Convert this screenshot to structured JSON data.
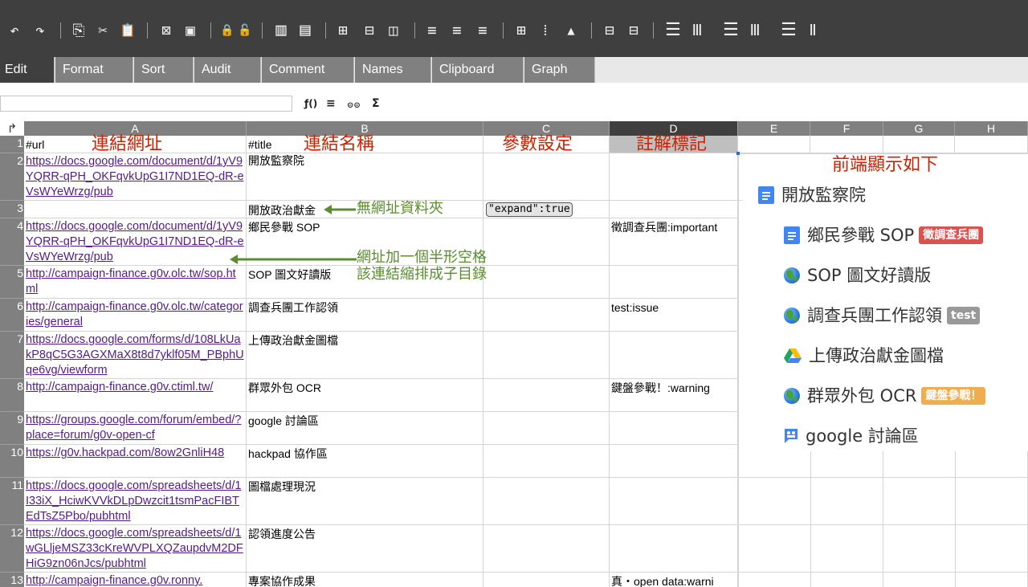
{
  "toolbar": {
    "buttons": [
      {
        "name": "undo-icon",
        "glyph": "↶"
      },
      {
        "name": "redo-icon",
        "glyph": "↷"
      },
      {
        "name": "copy-icon",
        "glyph": "⎘"
      },
      {
        "name": "cut-icon",
        "glyph": "✂"
      },
      {
        "name": "paste-icon",
        "glyph": "📋"
      },
      {
        "name": "delete-contents-icon",
        "glyph": "⊠"
      },
      {
        "name": "paste-formats-icon",
        "glyph": "▣"
      },
      {
        "name": "lock-icon",
        "glyph": "🔒"
      },
      {
        "name": "unlock-icon",
        "glyph": "🔓"
      },
      {
        "name": "freeze-columns-icon",
        "glyph": "▥"
      },
      {
        "name": "freeze-rows-icon",
        "glyph": "▤"
      },
      {
        "name": "merge-cells-icon",
        "glyph": "⊞"
      },
      {
        "name": "insert-row-icon",
        "glyph": "⊟"
      },
      {
        "name": "insert-column-icon",
        "glyph": "◫"
      },
      {
        "name": "align-left-icon",
        "glyph": "≡"
      },
      {
        "name": "align-center-icon",
        "glyph": "≡"
      },
      {
        "name": "align-right-icon",
        "glyph": "≡"
      },
      {
        "name": "borders-icon",
        "glyph": "⊞"
      },
      {
        "name": "no-borders-icon",
        "glyph": "⁞"
      },
      {
        "name": "fill-color-icon",
        "glyph": "▲"
      },
      {
        "name": "show-gridlines-icon",
        "glyph": "⊟"
      },
      {
        "name": "hide-gridlines-icon",
        "glyph": "⊟"
      },
      {
        "name": "insert-rows-icon",
        "glyph": "☰"
      },
      {
        "name": "insert-columns-icon",
        "glyph": "Ⅲ"
      },
      {
        "name": "delete-rows-icon",
        "glyph": "☰"
      },
      {
        "name": "delete-columns-icon",
        "glyph": "Ⅲ"
      },
      {
        "name": "hide-rows-icon",
        "glyph": "☰"
      },
      {
        "name": "hide-columns-icon",
        "glyph": "Ⅱ"
      }
    ]
  },
  "tabs": [
    "Edit",
    "Format",
    "Sort",
    "Audit",
    "Comment",
    "Names",
    "Clipboard",
    "Graph"
  ],
  "formula_bar": {
    "value": "",
    "icons": [
      {
        "name": "function-icon",
        "glyph": "ƒ()"
      },
      {
        "name": "multiline-icon",
        "glyph": "≡"
      },
      {
        "name": "link-icon",
        "glyph": "⊝⊝"
      },
      {
        "name": "sum-icon",
        "glyph": "Σ"
      }
    ]
  },
  "grid": {
    "corner_glyph": "↱",
    "columns": [
      "A",
      "B",
      "C",
      "D",
      "E",
      "F",
      "G",
      "H"
    ],
    "selected_column": "D",
    "rows": [
      {
        "num": "1",
        "a": "#url",
        "b": "#title",
        "c": "",
        "d": ""
      },
      {
        "num": "2",
        "a": "https://docs.google.com/document/d/1yV9YQRR-qPH_OKFqvkUpG1I7ND1EQ-dR-eVsWYeWrzg/pub",
        "b": "開放監察院",
        "c": "",
        "d": ""
      },
      {
        "num": "3",
        "a": "",
        "b": "開放政治獻金",
        "c": "",
        "d": ""
      },
      {
        "num": "4",
        "a": "https://docs.google.com/document/d/1yV9YQRR-qPH_OKFqvkUpG1I7ND1EQ-dR-eVsWYeWrzg/pub ",
        "b": "鄉民參戰 SOP",
        "c": "",
        "d": "徵調查兵團:important"
      },
      {
        "num": "5",
        "a": "http://campaign-finance.g0v.olc.tw/sop.html",
        "b": "SOP 圖文好讀版",
        "c": "",
        "d": ""
      },
      {
        "num": "6",
        "a": "http://campaign-finance.g0v.olc.tw/categories/general",
        "b": "調查兵團工作認領",
        "c": "",
        "d": "test:issue"
      },
      {
        "num": "7",
        "a": "https://docs.google.com/forms/d/108LkUakP8qC5G3AGXMaX8t8d7yklf05M_PBphUqe6vg/viewform",
        "b": "上傳政治獻金圖檔",
        "c": "",
        "d": ""
      },
      {
        "num": "8",
        "a": "http://campaign-finance.g0v.ctiml.tw/",
        "b": "群眾外包 OCR",
        "c": "",
        "d": "鍵盤參戰！:warning"
      },
      {
        "num": "9",
        "a": "https://groups.google.com/forum/embed/?place=forum/g0v-open-cf",
        "b": "google 討論區",
        "c": "",
        "d": ""
      },
      {
        "num": "10",
        "a": "https://g0v.hackpad.com/8ow2GnliH48",
        "b": "hackpad 協作區",
        "c": "",
        "d": ""
      },
      {
        "num": "11",
        "a": "https://docs.google.com/spreadsheets/d/1I33iX_HciwKVVkDLpDwzcit1tsmPacFIBTEdTsZ5Pbo/pubhtml",
        "b": "圖檔處理現況",
        "c": "",
        "d": ""
      },
      {
        "num": "12",
        "a": "https://docs.google.com/spreadsheets/d/1wGLljeMSZ33cKreWVPLXQZaupdvM2DFHiG9zn06nJcs/pubhtml",
        "b": "認領進度公告",
        "c": "",
        "d": ""
      },
      {
        "num": "13",
        "a": "http://campaign-finance.g0v.ronny.",
        "b": "專案協作成果",
        "c": "",
        "d": "真・open data:warni"
      }
    ]
  },
  "annotations": {
    "col_a_title": "連結網址",
    "col_b_title": "連結名稱",
    "col_c_title": "參數設定",
    "col_d_title": "註解標記",
    "param_tag": "\"expand\":true",
    "no_url_note": "無網址資料夾",
    "space_note_line1": "網址加一個半形空格",
    "space_note_line2": "該連結縮排成子目錄",
    "preview_title": "前端顯示如下"
  },
  "preview": {
    "items": [
      {
        "label": "開放監察院",
        "icon": "doc-icon",
        "badge": ""
      },
      {
        "label": "鄉民參戰 SOP",
        "icon": "doc-icon",
        "badge": "徵調查兵團",
        "badge_color": "#d9534f"
      },
      {
        "label": "SOP 圖文好讀版",
        "icon": "globe-icon",
        "badge": ""
      },
      {
        "label": "調查兵團工作認領",
        "icon": "globe-icon",
        "badge": "test",
        "badge_color": "#999999"
      },
      {
        "label": "上傳政治獻金圖檔",
        "icon": "drive-icon",
        "badge": ""
      },
      {
        "label": "群眾外包 OCR",
        "icon": "globe-icon",
        "badge": "鍵盤參戰！",
        "badge_color": "#f0ad4e"
      },
      {
        "label": "google 討論區",
        "icon": "group-icon",
        "badge": ""
      }
    ]
  },
  "colors": {
    "toolbar_bg": "#3f3f3f",
    "tab_bg": "#808080",
    "link": "#551a8b",
    "annotation_red": "#cc2200",
    "annotation_green": "#5a8c30",
    "doc_blue": "#4285f4"
  }
}
